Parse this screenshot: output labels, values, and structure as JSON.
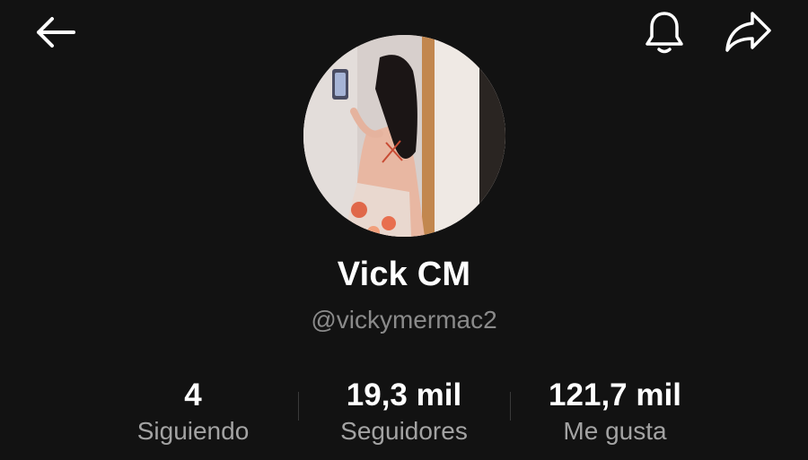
{
  "header": {
    "back_icon": "arrow-left-icon",
    "notification_icon": "bell-icon",
    "share_icon": "share-arrow-icon"
  },
  "profile": {
    "display_name": "Vick CM",
    "username": "@vickymermac2"
  },
  "stats": [
    {
      "value": "4",
      "label": "Siguiendo"
    },
    {
      "value": "19,3 mil",
      "label": "Seguidores"
    },
    {
      "value": "121,7 mil",
      "label": "Me gusta"
    }
  ],
  "colors": {
    "background": "#121212",
    "primary_text": "#ffffff",
    "secondary_text": "#8a8a8a"
  }
}
